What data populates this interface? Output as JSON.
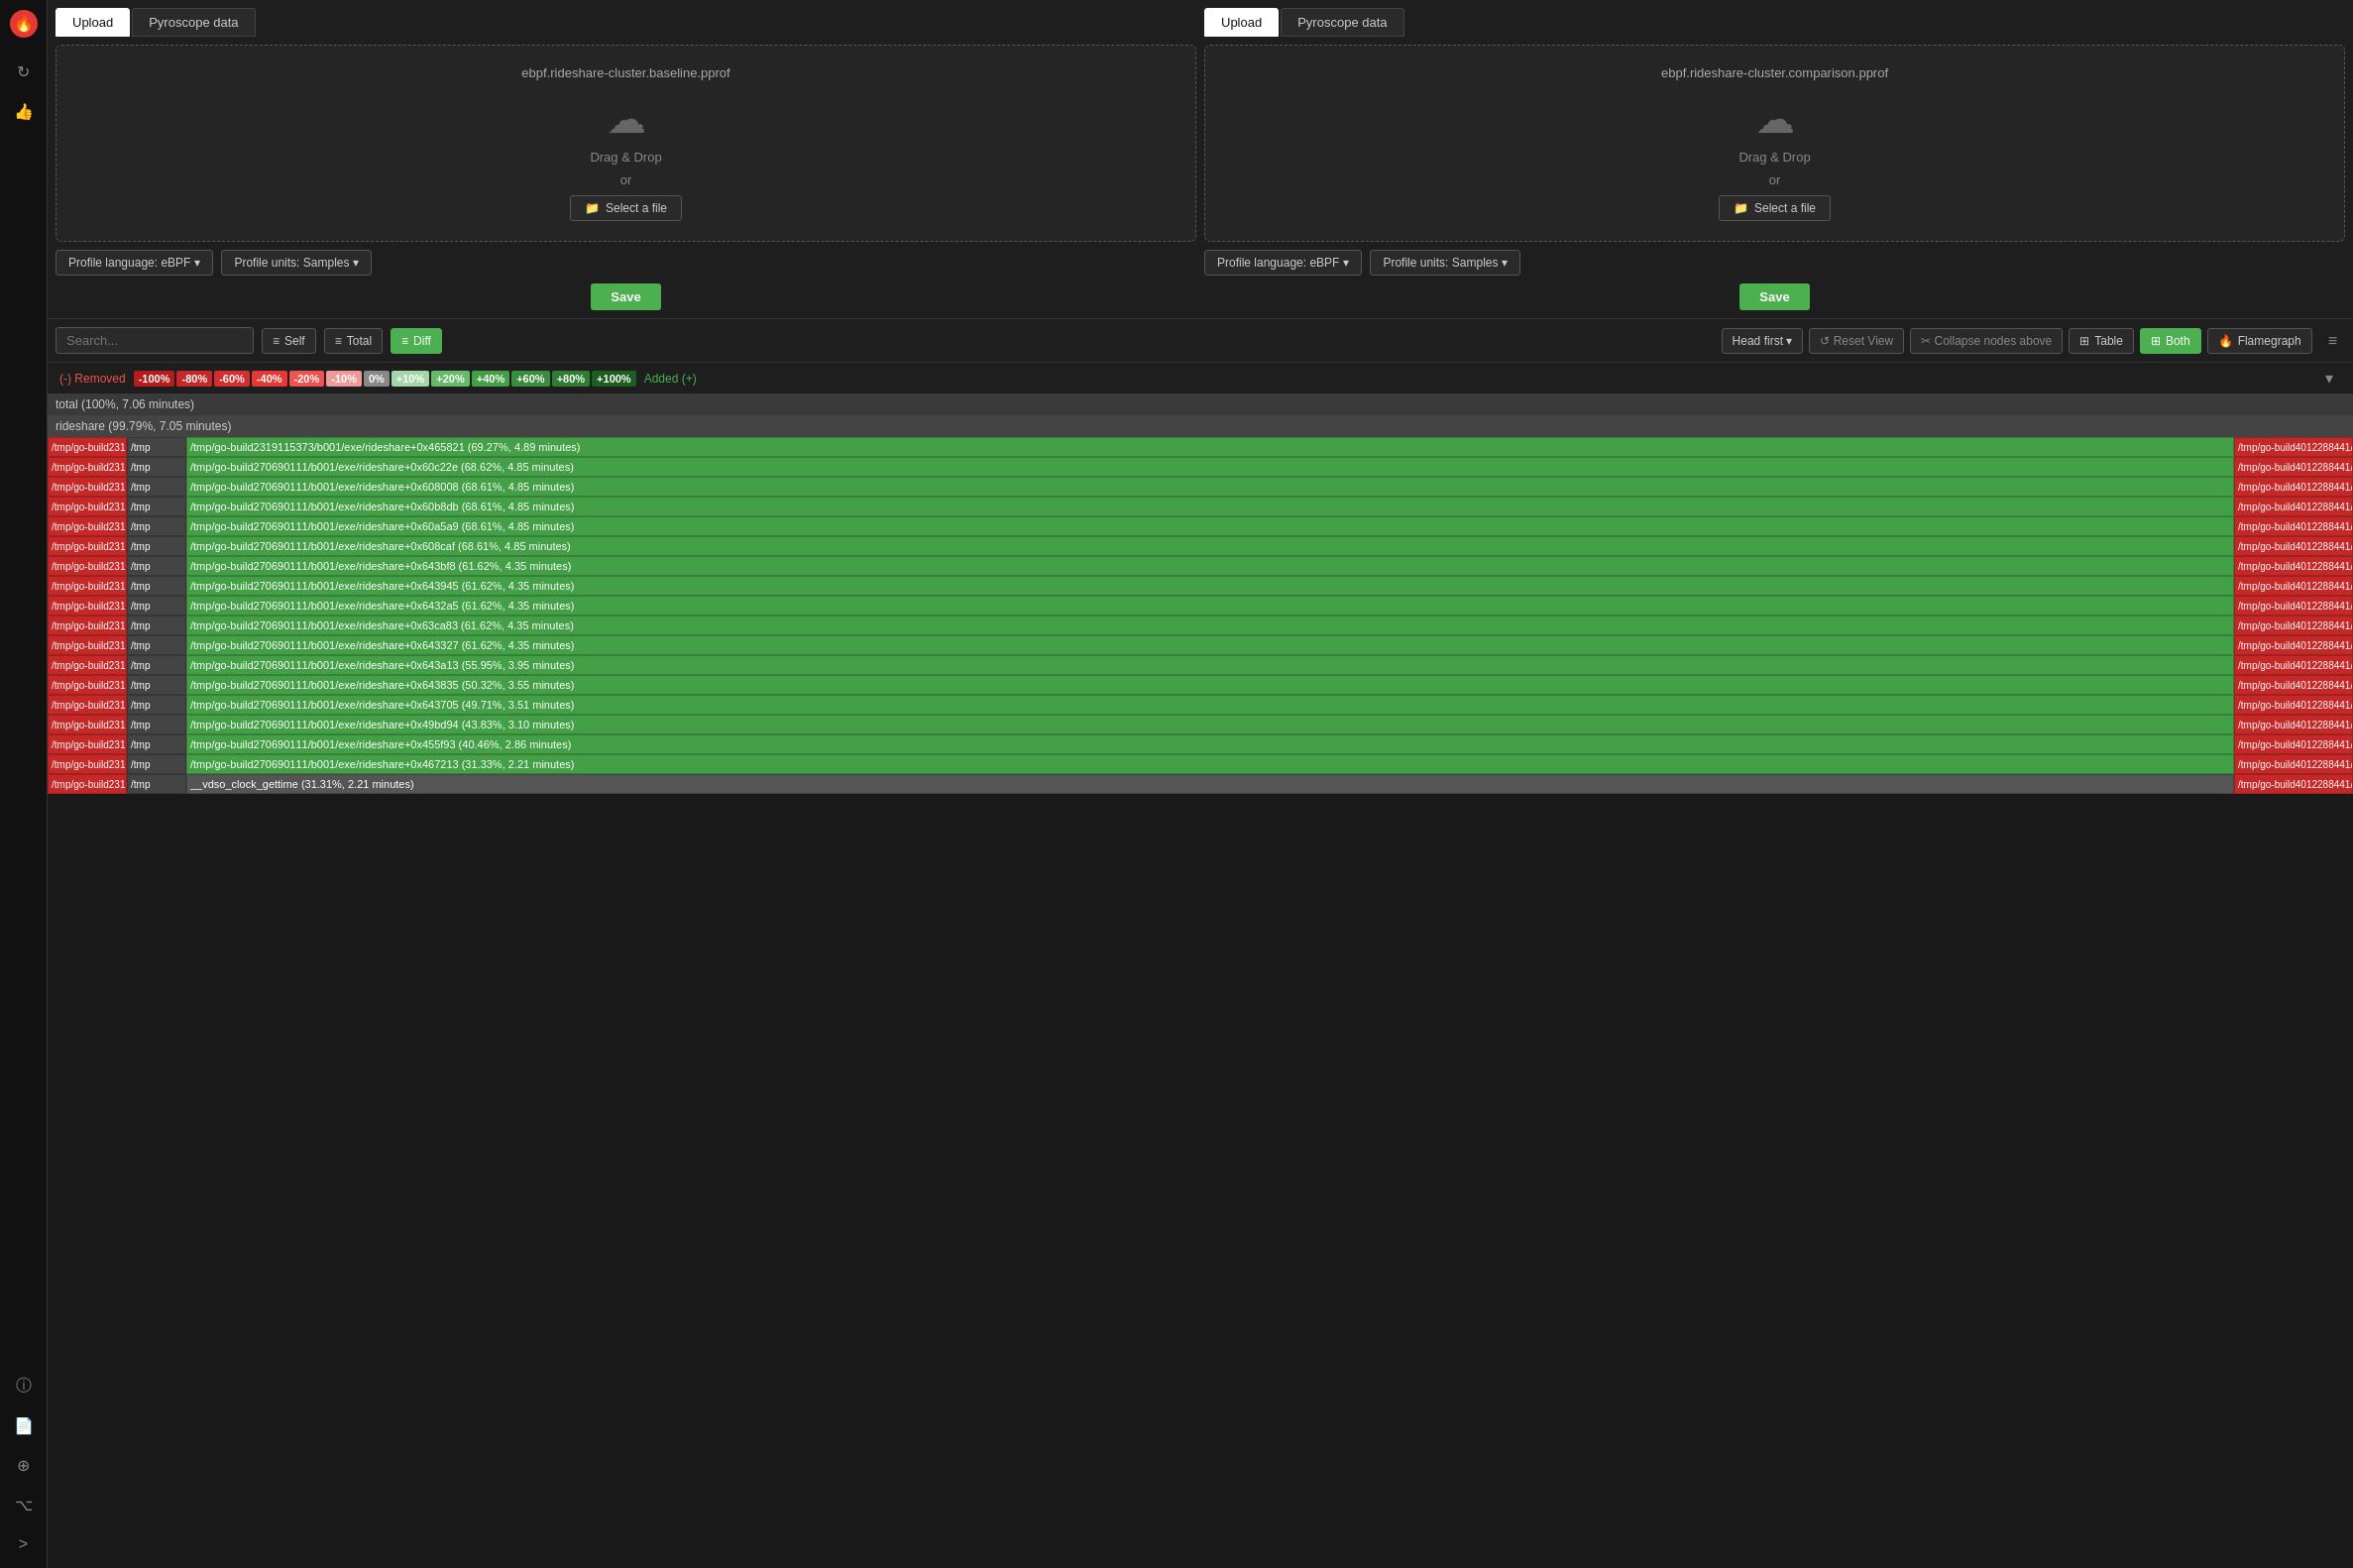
{
  "sidebar": {
    "items": [
      {
        "name": "flame-icon",
        "label": "Flame",
        "icon": "🔥",
        "active": true
      },
      {
        "name": "refresh-icon",
        "label": "Refresh",
        "icon": "↻"
      },
      {
        "name": "thumbs-up-icon",
        "label": "Like",
        "icon": "👍"
      },
      {
        "name": "info-icon",
        "label": "Info",
        "icon": "ℹ"
      },
      {
        "name": "docs-icon",
        "label": "Docs",
        "icon": "📄"
      },
      {
        "name": "settings-icon",
        "label": "Settings",
        "icon": "⊕"
      },
      {
        "name": "github-icon",
        "label": "GitHub",
        "icon": "⌥"
      },
      {
        "name": "expand-icon",
        "label": "Expand",
        "icon": ">"
      }
    ]
  },
  "left_panel": {
    "tabs": [
      "Upload",
      "Pyroscope data"
    ],
    "active_tab": "Upload",
    "filename": "ebpf.rideshare-cluster.baseline.pprof",
    "drag_drop_text": "Drag & Drop",
    "or_text": "or",
    "select_file_label": "Select a file",
    "profile_language_label": "Profile language: eBPF",
    "profile_units_label": "Profile units: Samples",
    "save_label": "Save"
  },
  "right_panel": {
    "tabs": [
      "Upload",
      "Pyroscope data"
    ],
    "active_tab": "Upload",
    "filename": "ebpf.rideshare-cluster.comparison.pprof",
    "drag_drop_text": "Drag & Drop",
    "or_text": "or",
    "select_file_label": "Select a file",
    "profile_language_label": "Profile language: eBPF",
    "profile_units_label": "Profile units: Samples",
    "save_label": "Save"
  },
  "toolbar": {
    "search_placeholder": "Search...",
    "self_label": "Self",
    "total_label": "Total",
    "diff_label": "Diff",
    "head_first_label": "Head first",
    "reset_view_label": "Reset View",
    "collapse_nodes_label": "Collapse nodes above",
    "table_label": "Table",
    "both_label": "Both",
    "flamegraph_label": "Flamegraph",
    "menu_icon": "≡"
  },
  "diff_legend": {
    "removed_label": "(-) Removed",
    "added_label": "Added (+)",
    "chips": [
      "-100%",
      "-80%",
      "-60%",
      "-40%",
      "-20%",
      "-10%",
      "0%",
      "+10%",
      "+20%",
      "+40%",
      "+60%",
      "+80%",
      "+100%"
    ],
    "chip_colors": [
      "#b71c1c",
      "#c62828",
      "#d32f2f",
      "#e53935",
      "#ef5350",
      "#ef9a9a",
      "#888888",
      "#a5d6a7",
      "#66bb6a",
      "#43a047",
      "#388e3c",
      "#2e7d32",
      "#1b5e20"
    ]
  },
  "flamegraph": {
    "total_row": "total (100%, 7.06 minutes)",
    "rideshare_row": "rideshare (99.79%, 7.05 minutes)",
    "rows": [
      {
        "label": "/tmp/go-build2319115373/b001/exe/rideshare+0x465821 (69.27%, 4.89 minutes)",
        "color": "bright-green",
        "width_pct": 72
      },
      {
        "label": "/tmp/go-build270690111/b001/exe/rideshare+0x60c22e (68.62%, 4.85 minutes)",
        "color": "bright-green",
        "width_pct": 71
      },
      {
        "label": "/tmp/go-build270690111/b001/exe/rideshare+0x608008 (68.61%, 4.85 minutes)",
        "color": "bright-green",
        "width_pct": 71
      },
      {
        "label": "/tmp/go-build270690111/b001/exe/rideshare+0x60b8db (68.61%, 4.85 minutes)",
        "color": "bright-green",
        "width_pct": 71
      },
      {
        "label": "/tmp/go-build270690111/b001/exe/rideshare+0x60a5a9 (68.61%, 4.85 minutes)",
        "color": "bright-green",
        "width_pct": 71
      },
      {
        "label": "/tmp/go-build270690111/b001/exe/rideshare+0x608caf (68.61%, 4.85 minutes)",
        "color": "bright-green",
        "width_pct": 71
      },
      {
        "label": "/tmp/go-build270690111/b001/exe/rideshare+0x643bf8 (61.62%, 4.35 minutes)",
        "color": "bright-green",
        "width_pct": 64
      },
      {
        "label": "/tmp/go-build270690111/b001/exe/rideshare+0x643945 (61.62%, 4.35 minutes)",
        "color": "bright-green",
        "width_pct": 64
      },
      {
        "label": "/tmp/go-build270690111/b001/exe/rideshare+0x6432a5 (61.62%, 4.35 minutes)",
        "color": "bright-green",
        "width_pct": 64
      },
      {
        "label": "/tmp/go-build270690111/b001/exe/rideshare+0x63ca83 (61.62%, 4.35 minutes)",
        "color": "bright-green",
        "width_pct": 64
      },
      {
        "label": "/tmp/go-build270690111/b001/exe/rideshare+0x643327 (61.62%, 4.35 minutes)",
        "color": "bright-green",
        "width_pct": 64
      },
      {
        "label": "/tmp/go-build270690111/b001/exe/rideshare+0x643a13 (55.95%, 3.95 minutes)",
        "color": "bright-green",
        "width_pct": 58
      },
      {
        "label": "/tmp/go-build270690111/b001/exe/rideshare+0x643835 (50.32%, 3.55 minutes)",
        "color": "bright-green",
        "width_pct": 52
      },
      {
        "label": "/tmp/go-build270690111/b001/exe/rideshare+0x643705 (49.71%, 3.51 minutes)",
        "color": "bright-green",
        "width_pct": 51
      },
      {
        "label": "/tmp/go-build270690111/b001/exe/rideshare+0x49bd94 (43.83%, 3.10 minutes)",
        "color": "bright-green",
        "width_pct": 45
      },
      {
        "label": "/tmp/go-build270690111/b001/exe/rideshare+0x455f93 (40.46%, 2.86 minutes)",
        "color": "bright-green",
        "width_pct": 42
      },
      {
        "label": "/tmp/go-build270690111/b001/exe/rideshare+0x467213 (31.33%, 2.21 minutes)",
        "color": "bright-green",
        "width_pct": 32
      },
      {
        "label": "__vdso_clock_gettime (31.31%, 2.21 minutes)",
        "color": "gray",
        "width_pct": 32
      }
    ]
  }
}
